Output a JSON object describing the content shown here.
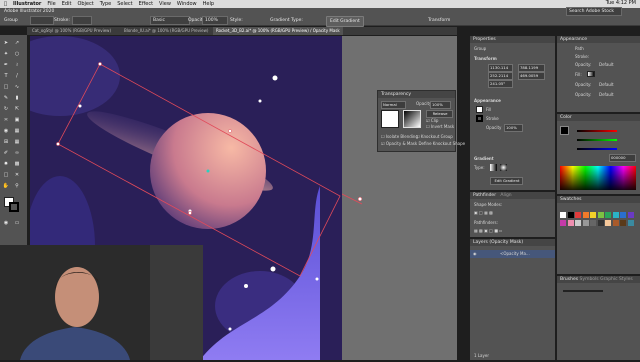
{
  "menubar": {
    "items": [
      "Illustrator",
      "File",
      "Edit",
      "Object",
      "Type",
      "Select",
      "Effect",
      "View",
      "Window",
      "Help"
    ],
    "status": "Tue 4:12 PM"
  },
  "control": {
    "selection_type": "Group",
    "stroke_label": "Stroke:",
    "brush_label": "Basic",
    "opacity_label": "Opacity:",
    "opacity_value": "100%",
    "style_label": "Style:",
    "gradient_type_label": "Gradient Type:",
    "edit_gradient_button": "Edit Gradient",
    "transform_label": "Transform",
    "app_title": "Adobe Illustrator 2020",
    "search_placeholder": "Search Adobe Stock"
  },
  "tabs": [
    {
      "label": "Cat_ogStyl @ 100% (RGB/GPU Preview)",
      "active": false
    },
    {
      "label": "Blonde_IU.ai* @ 100% (RGB/GPU Preview)",
      "active": false
    },
    {
      "label": "Rocket_3D_B2.ai* @ 100% (RGB/GPU Preview) / Opacity Mask",
      "active": true
    }
  ],
  "transparency": {
    "title": "Transparency",
    "blend_mode": "Normal",
    "opacity_label": "Opacity:",
    "opacity_value": "100%",
    "release_button": "Release",
    "clip_label": "Clip",
    "invert_mask_label": "Invert Mask",
    "isolate_blending": "Isolate Blending",
    "knockout_group": "Knockout Group",
    "opacity_mask_define": "Opacity & Mask Define Knockout Shape"
  },
  "properties": {
    "tab_label": "Properties",
    "section_group": "Group",
    "transform_heading": "Transform",
    "x_value": "1130.114",
    "y_value": "252.2114",
    "w_value": "788.1199",
    "h_value": "469.0059",
    "angle_value": "241.05°",
    "appearance_heading": "Appearance",
    "fill_label": "Fill",
    "stroke_label": "Stroke",
    "opacity_label": "Opacity",
    "opacity_value": "100%",
    "gradient_heading": "Gradient",
    "gradient_type_label": "Type:",
    "edit_gradient_button": "Edit Gradient"
  },
  "pathfinder": {
    "tab1": "Pathfinder",
    "tab2": "Align",
    "shape_modes": "Shape Modes:",
    "pathfinders": "Pathfinders:"
  },
  "layers": {
    "title": "Layers (Opacity Mask)",
    "row_label": "<Opacity Ma...",
    "footer": "1 Layer"
  },
  "appearance_panel": {
    "title": "Appearance",
    "object": "Path",
    "stroke_label": "Stroke:",
    "fill_label": "Fill:",
    "opacity_label": "Opacity:",
    "opacity_value": "Default"
  },
  "color_panel": {
    "title": "Color",
    "hex_value": "000000"
  },
  "swatches": {
    "title": "Swatches",
    "colors": [
      "#ffffff",
      "#000000",
      "#e03b3b",
      "#f07a2a",
      "#f3d02a",
      "#7cc242",
      "#2aa65a",
      "#2ab3c6",
      "#2a6fd0",
      "#6a3ac4",
      "#c43aa8",
      "#ef8fb0",
      "#cccccc",
      "#999999",
      "#666666",
      "#333333",
      "#f6c89a",
      "#a85a2a",
      "#5a3a1a",
      "#3a8aa0"
    ]
  },
  "brushes": {
    "tab1": "Brushes",
    "tab2": "Symbols",
    "tab3": "Graphic Styles"
  },
  "colors": {
    "ui_dark": "#535353",
    "ui_darker": "#3b3b3b",
    "art_bg": "#2a1f58",
    "planet_light": "#f2a99a",
    "planet_dark": "#5a3a7a",
    "wave": "#6f5ad6",
    "selection": "#e14a5a"
  }
}
